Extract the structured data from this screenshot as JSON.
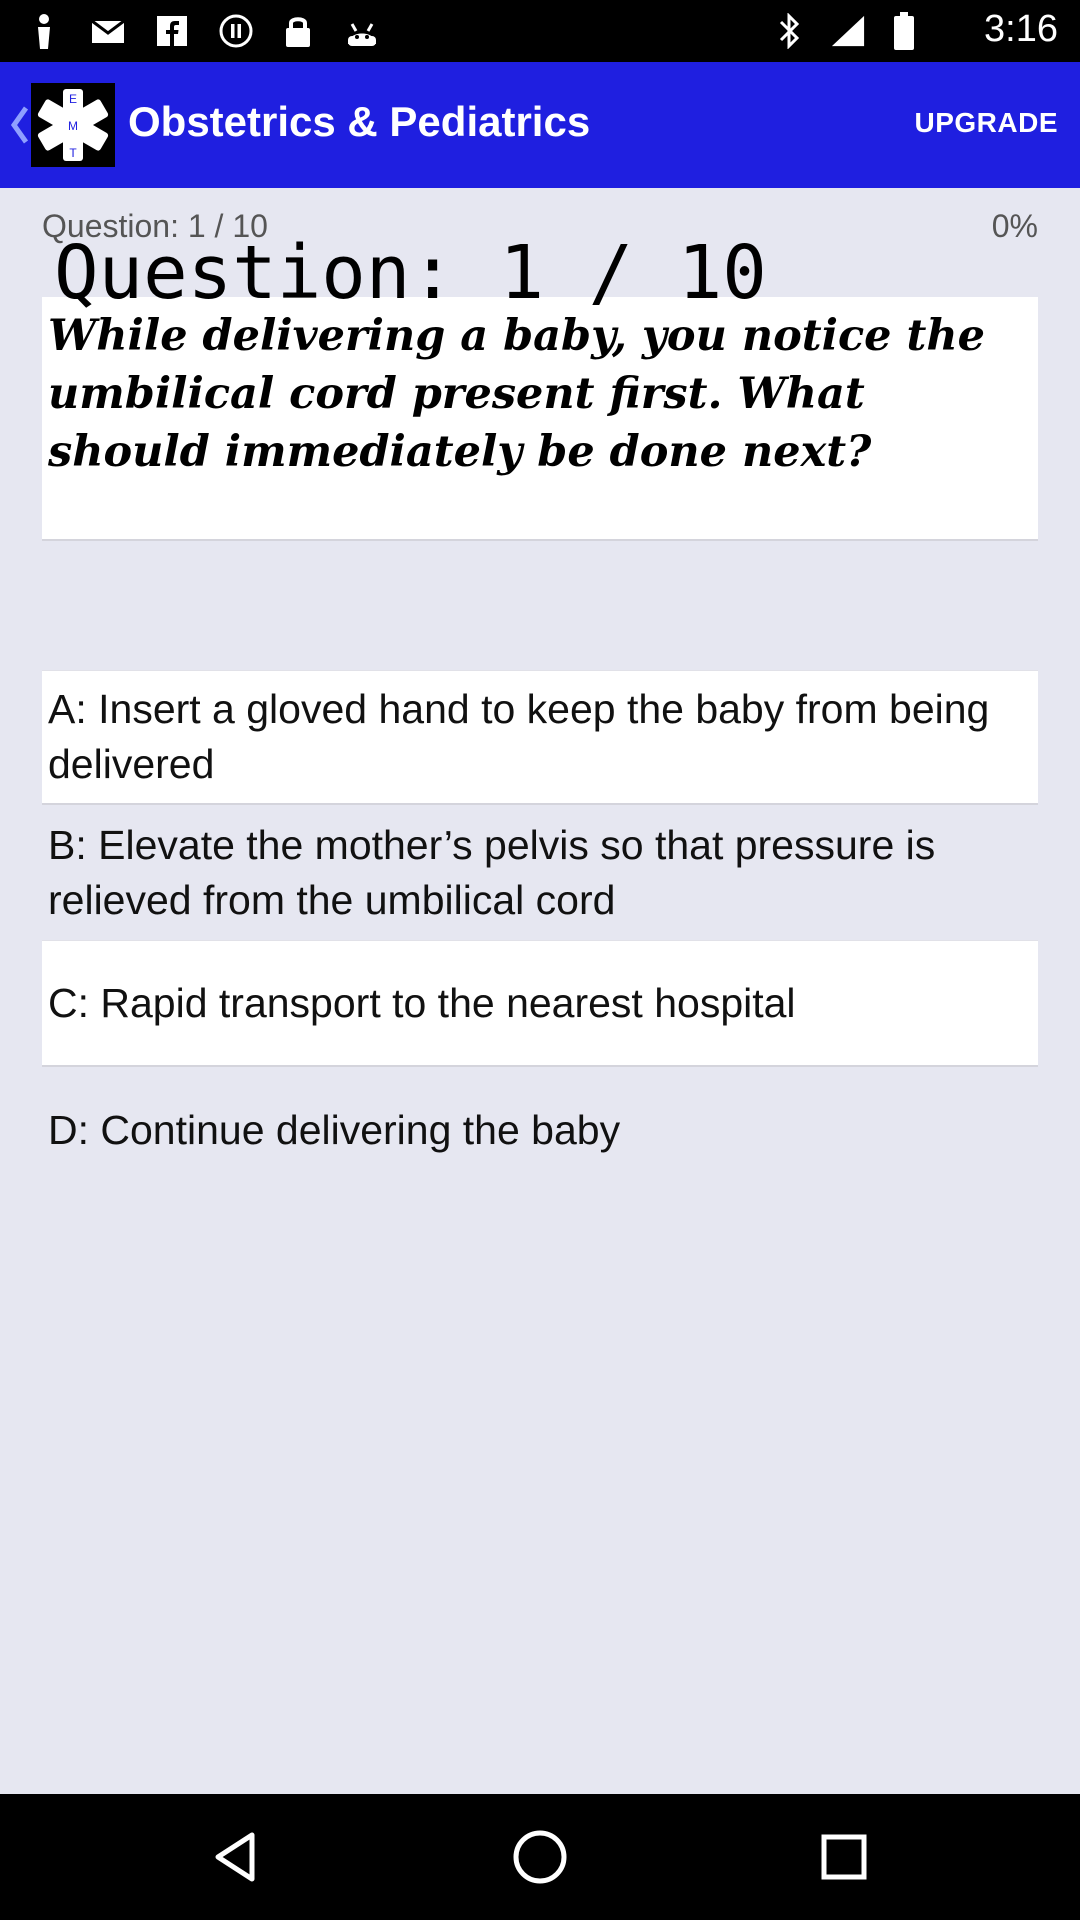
{
  "status_bar": {
    "time": "3:16",
    "icons": [
      "runner-icon",
      "mail-icon",
      "facebook-icon",
      "pause-circle-icon",
      "lock-icon",
      "android-icon",
      "bluetooth-icon",
      "signal-icon",
      "battery-icon"
    ]
  },
  "app_bar": {
    "title": "Obstetrics & Pediatrics",
    "upgrade_label": "UPGRADE",
    "logo_letters": [
      "E",
      "M",
      "T"
    ],
    "color": "#1f1fe0"
  },
  "quiz": {
    "question_counter": "Question: 1 / 10",
    "progress_percent": "0%",
    "overlay_title": "Question: 1 / 10",
    "question_text": "While delivering a baby, you notice the umbilical cord present first. What should immediately be done next?",
    "answers": [
      {
        "text": "A: Insert a gloved hand to keep the baby from being delivered"
      },
      {
        "text": "B: Elevate the mother’s pelvis so that pressure is relieved from the umbilical cord"
      },
      {
        "text": "C: Rapid transport to the nearest hospital"
      },
      {
        "text": "D: Continue delivering the baby"
      }
    ]
  },
  "nav_bar": {
    "buttons": [
      "back-triangle-icon",
      "home-circle-icon",
      "recents-square-icon"
    ]
  }
}
